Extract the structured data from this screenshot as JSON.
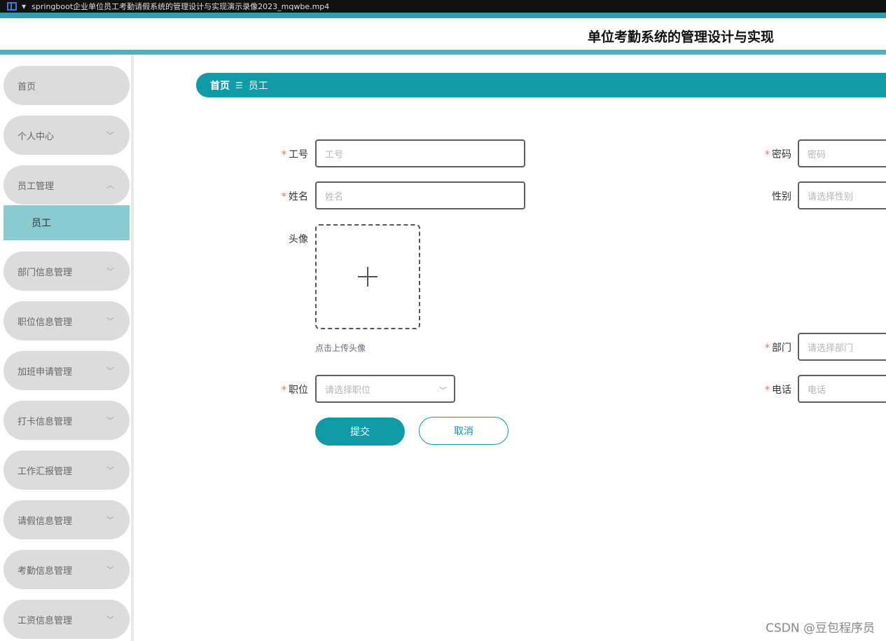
{
  "window": {
    "title": "springboot企业单位员工考勤请假系统的管理设计与实现演示录像2023_mqwbe.mp4"
  },
  "header": {
    "site_title": "单位考勤系统的管理设计与实现"
  },
  "sidebar": {
    "items": [
      {
        "label": "首页",
        "expandable": false
      },
      {
        "label": "个人中心",
        "expandable": true
      },
      {
        "label": "员工管理",
        "expandable": true,
        "expanded": true
      },
      {
        "label": "部门信息管理",
        "expandable": true
      },
      {
        "label": "职位信息管理",
        "expandable": true
      },
      {
        "label": "加班申请管理",
        "expandable": true
      },
      {
        "label": "打卡信息管理",
        "expandable": true
      },
      {
        "label": "工作汇报管理",
        "expandable": true
      },
      {
        "label": "请假信息管理",
        "expandable": true
      },
      {
        "label": "考勤信息管理",
        "expandable": true
      },
      {
        "label": "工资信息管理",
        "expandable": true
      }
    ],
    "active_subitem": "员工"
  },
  "breadcrumb": {
    "home": "首页",
    "separator": "☰",
    "current": "员工"
  },
  "form": {
    "employee_no": {
      "label": "工号",
      "required": true,
      "placeholder": "工号"
    },
    "password": {
      "label": "密码",
      "required": true,
      "placeholder": "密码"
    },
    "name": {
      "label": "姓名",
      "required": true,
      "placeholder": "姓名"
    },
    "gender": {
      "label": "性别",
      "required": false,
      "placeholder": "请选择性别"
    },
    "avatar": {
      "label": "头像",
      "required": false,
      "hint": "点击上传头像"
    },
    "department": {
      "label": "部门",
      "required": true,
      "placeholder": "请选择部门"
    },
    "position": {
      "label": "职位",
      "required": true,
      "placeholder": "请选择职位"
    },
    "phone": {
      "label": "电话",
      "required": true,
      "placeholder": "电话"
    },
    "submit_label": "提交",
    "cancel_label": "取消"
  },
  "watermark": "CSDN @豆包程序员",
  "colors": {
    "accent": "#0f9aa6",
    "menu_bg": "#dcdcdc",
    "active_sub_bg": "#88ccd2",
    "required_star": "#e4774d"
  }
}
